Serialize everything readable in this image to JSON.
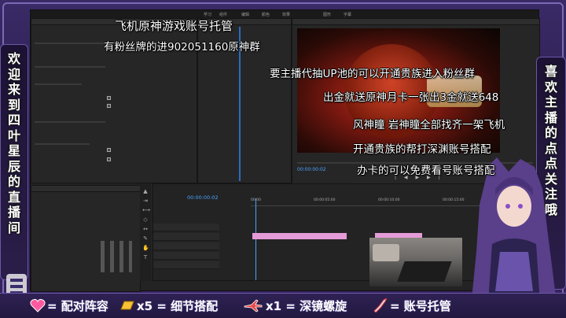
{
  "left_banner": "欢迎来到四叶星辰的直播间",
  "right_banner": "喜欢主播的点点关注哦",
  "overlay_lines": [
    "飞机原神游戏账号托管",
    "有粉丝牌的进902051160原神群",
    "要主播代抽UP池的可以开通贵族进入粉丝群",
    "出金就送原神月卡一张出3金就送648",
    "风神瞳 岩神瞳全部找齐一架飞机",
    "开通贵族的帮打深渊账号搭配",
    "办卡的可以免费看号账号搭配"
  ],
  "bottom": [
    {
      "icon": "heart-icon",
      "text": "= 配对阵容"
    },
    {
      "icon": "gold-bar-icon",
      "text": "x5 = 细节搭配"
    },
    {
      "icon": "airplane-icon",
      "text": "x1 = 深镜螺旋"
    },
    {
      "icon": "rocket-icon",
      "text": "= 账号托管"
    }
  ],
  "editor": {
    "timecode_program": "00:00:00:02",
    "timecode_sequence": "00:00:00:02",
    "ruler": [
      "00:00",
      "00:00:05:00",
      "00:00:10:00",
      "00:00:15:00"
    ]
  },
  "colors": {
    "accent": "#9a86d8",
    "clip_pink": "#e59bd8",
    "timecode_blue": "#4aa3ff"
  }
}
